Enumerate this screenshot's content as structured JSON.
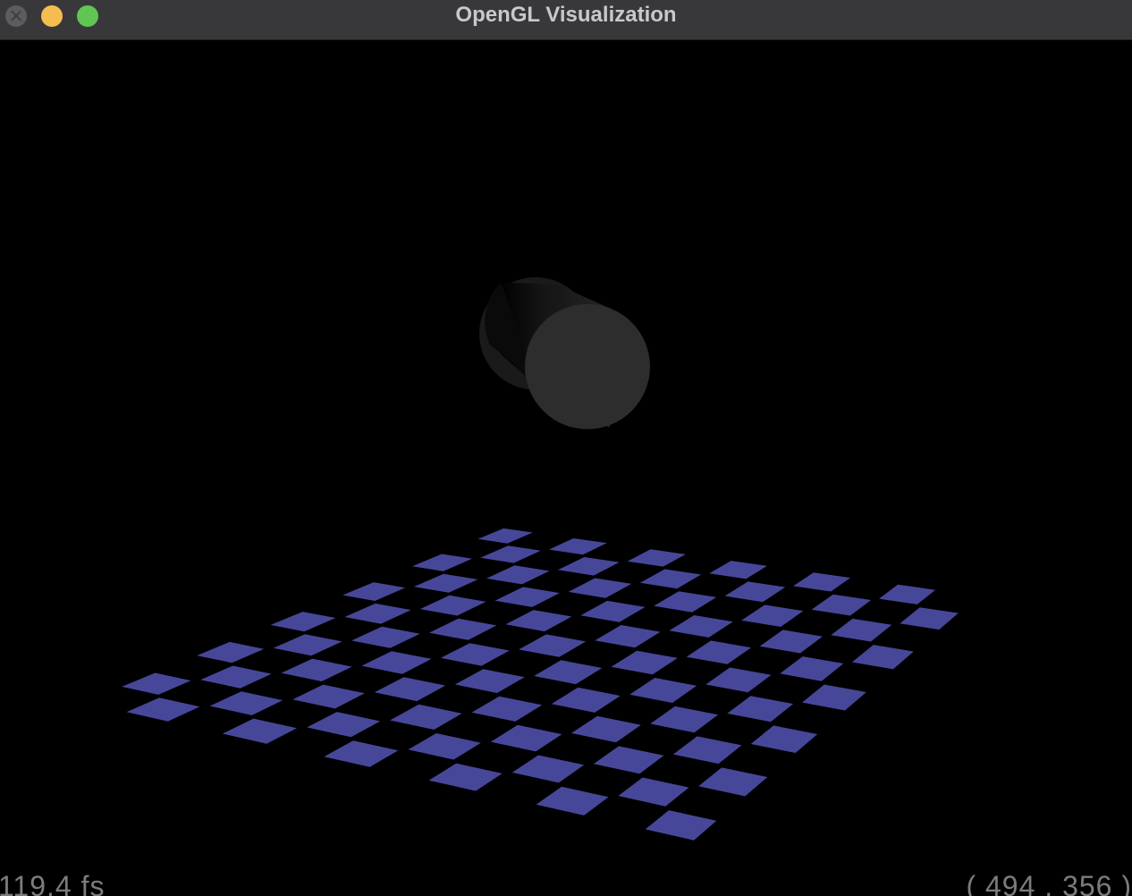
{
  "window": {
    "title": "OpenGL Visualization",
    "controls": {
      "close": "close-icon",
      "minimize": "minimize-icon",
      "zoom": "zoom-icon"
    }
  },
  "scene": {
    "background_color": "#000000",
    "floor": {
      "type": "checkerboard",
      "tile_color": "#47479a",
      "gap_color": "#000000"
    },
    "object": {
      "type": "cylinder",
      "color": "#2d2d2d"
    }
  },
  "overlay": {
    "fps": "119.4 fs",
    "cursor": "( 494 , 356 )"
  }
}
